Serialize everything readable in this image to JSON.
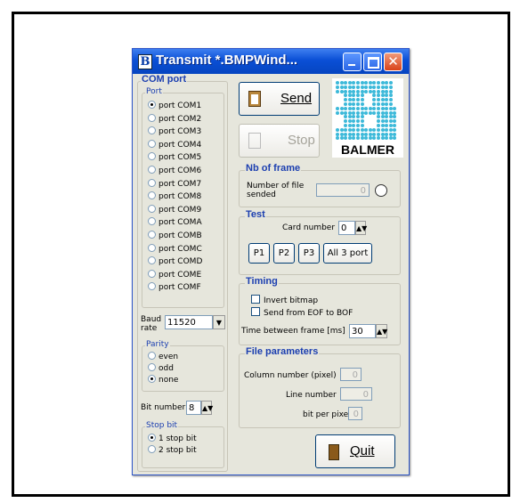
{
  "window": {
    "title": "Transmit *.BMPWind...",
    "icon_letter": "B"
  },
  "com_port": {
    "title": "COM port",
    "port_group": "Port",
    "ports": [
      "port COM1",
      "port COM2",
      "port COM3",
      "port COM4",
      "port COM5",
      "port COM6",
      "port COM7",
      "port COM8",
      "port COM9",
      "port COMA",
      "port COMB",
      "port COMC",
      "port COMD",
      "port COME",
      "port COMF"
    ],
    "selected_port": "port COM1",
    "baud_label_1": "Baud",
    "baud_label_2": "rate",
    "baud_value": "11520",
    "parity_group": "Parity",
    "parity": [
      "even",
      "odd",
      "none"
    ],
    "selected_parity": "none",
    "bit_number_label": "Bit number",
    "bit_number_value": "8",
    "stop_bit_group": "Stop bit",
    "stop_bits": [
      "1 stop bit",
      "2 stop bit"
    ],
    "selected_stop_bit": "1 stop bit"
  },
  "actions": {
    "send": "Send",
    "stop": "Stop",
    "quit": "Quit"
  },
  "logo": {
    "text": "BALMER"
  },
  "nb_frame": {
    "title": "Nb of frame",
    "label_1": "Number of file",
    "label_2": "sended",
    "value": "0"
  },
  "test": {
    "title": "Test",
    "card_label": "Card number",
    "card_value": "0",
    "buttons": [
      "P1",
      "P2",
      "P3",
      "All 3 port"
    ]
  },
  "timing": {
    "title": "Timing",
    "invert": "Invert bitmap",
    "send_eof": "Send from EOF to BOF",
    "time_label": "Time between frame [ms]",
    "time_value": "30"
  },
  "file_params": {
    "title": "File parameters",
    "column_label": "Column number (pixel)",
    "column_value": "0",
    "line_label": "Line number",
    "line_value": "0",
    "bpp_label": "bit per pixel",
    "bpp_value": "0"
  },
  "colors": {
    "titlebar": "#0a4fd6",
    "group_title": "#1c3fb0",
    "logo": "#3cb9d9",
    "window_bg": "#e6e6dc"
  }
}
